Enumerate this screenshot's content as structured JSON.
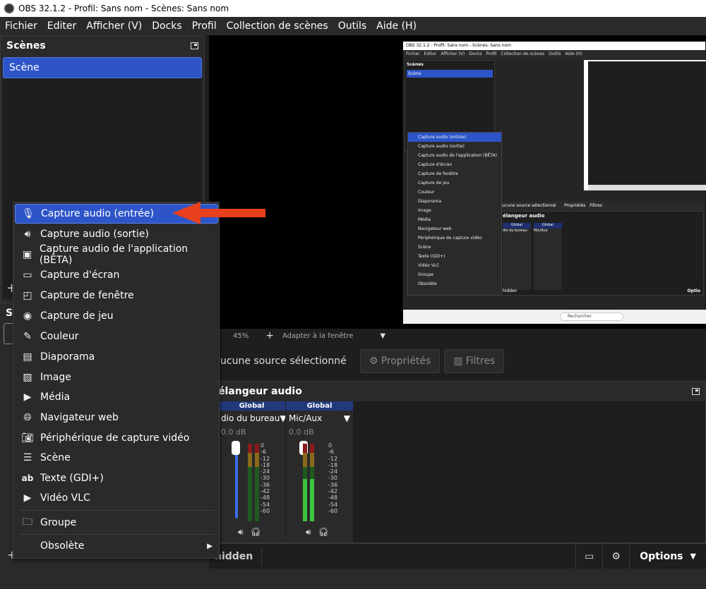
{
  "window": {
    "title": "OBS 32.1.2 - Profil: Sans nom - Scènes: Sans nom"
  },
  "menu": [
    "Fichier",
    "Editer",
    "Afficher (V)",
    "Docks",
    "Profil",
    "Collection de scènes",
    "Outils",
    "Aide (H)"
  ],
  "scenes": {
    "header": "Scènes",
    "items": [
      "Scène"
    ]
  },
  "sources_partial_label": "S",
  "context_menu": {
    "items": [
      {
        "label": "Capture audio (entrée)",
        "icon": "microphone-icon",
        "selected": true
      },
      {
        "label": "Capture audio (sortie)",
        "icon": "speaker-icon"
      },
      {
        "label": "Capture audio de l'application (BÊTA)",
        "icon": "app-audio-icon"
      },
      {
        "label": "Capture d'écran",
        "icon": "monitor-icon"
      },
      {
        "label": "Capture de fenêtre",
        "icon": "window-icon"
      },
      {
        "label": "Capture de jeu",
        "icon": "gamepad-icon"
      },
      {
        "label": "Couleur",
        "icon": "brush-icon"
      },
      {
        "label": "Diaporama",
        "icon": "slideshow-icon"
      },
      {
        "label": "Image",
        "icon": "image-icon"
      },
      {
        "label": "Média",
        "icon": "play-icon"
      },
      {
        "label": "Navigateur web",
        "icon": "globe-icon"
      },
      {
        "label": "Périphérique de capture vidéo",
        "icon": "camera-icon"
      },
      {
        "label": "Scène",
        "icon": "list-icon"
      },
      {
        "label": "Texte (GDI+)",
        "icon": "text-icon"
      },
      {
        "label": "Vidéo VLC",
        "icon": "play-icon"
      }
    ],
    "group": "Groupe",
    "obsolete": "Obsolète"
  },
  "preview_toolbar": {
    "zoom": "45%",
    "fit": "Adapter à la fenêtre"
  },
  "source_bar": {
    "no_source": "ucune source sélectionné",
    "properties": "Propriétés",
    "filters": "Filtres"
  },
  "mixer": {
    "title": "élangeur audio",
    "channels": [
      {
        "scope": "Global",
        "device": "dio du bureau",
        "db": "0.0 dB",
        "level": 0.0
      },
      {
        "scope": "Global",
        "device": "Mic/Aux",
        "db": "0.0 dB",
        "level": 0.55
      }
    ],
    "ticks": [
      "0",
      "-6",
      "-12",
      "-18",
      "-24",
      "-30",
      "-36",
      "-42",
      "-48",
      "-54",
      "-60"
    ]
  },
  "bottom": {
    "hidden": "hidden",
    "options": "Options"
  },
  "inner_screenshot": {
    "title": "OBS 32.1.2 - Profil: Sans nom - Scènes: Sans nom",
    "menu": [
      "Fichier",
      "Editer",
      "Afficher (V)",
      "Docks",
      "Profil",
      "Collection de scènes",
      "Outils",
      "Aide (H)"
    ],
    "scenes_header": "Scènes",
    "scene": "Scène",
    "menu_items": [
      "Capture audio (entrée)",
      "Capture audio (sortie)",
      "Capture audio de l'application (BÊTA)",
      "Capture d'écran",
      "Capture de fenêtre",
      "Capture de jeu",
      "Couleur",
      "Diaporama",
      "Image",
      "Média",
      "Navigateur web",
      "Périphérique de capture vidéo",
      "Scène",
      "Texte (GDI+)",
      "Vidéo VLC",
      "Groupe",
      "Obsolète"
    ],
    "no_source": "ucune source sélectionné",
    "properties": "Propriétés",
    "filters": "Filtres",
    "mixer_title": "élangeur audio",
    "ch1": "dio du bureau",
    "ch2": "Mic/Aux",
    "search": "Rechercher",
    "hidden": "hidden",
    "options": "Optio"
  },
  "colors": {
    "accent": "#2d55c9",
    "arrow": "#e8401c",
    "fader": "#3f6be8",
    "meter_green": "#3cc43c"
  }
}
